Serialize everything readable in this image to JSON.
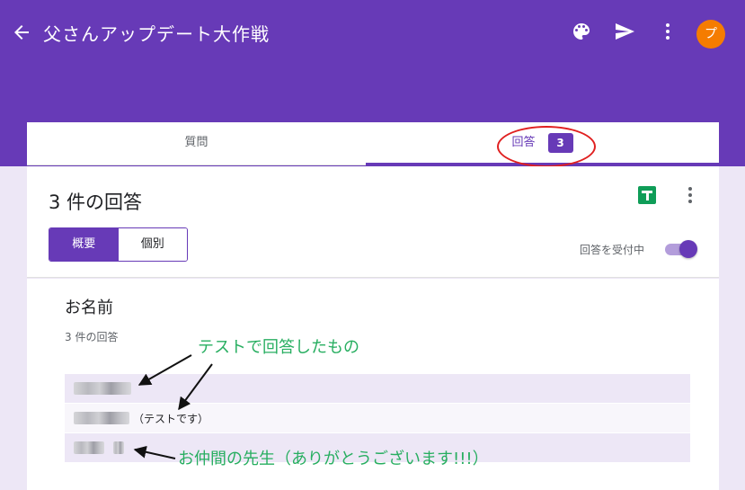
{
  "header": {
    "title": "父さんアップデート大作戦",
    "avatar_initial": "プ",
    "icons": [
      "back-arrow-icon",
      "palette-icon",
      "send-icon",
      "more-vert-icon"
    ],
    "bg_color": "#673ab7"
  },
  "tabs": [
    {
      "label": "質問"
    },
    {
      "label": "回答",
      "badge": "3",
      "active": true
    }
  ],
  "summary": {
    "response_count": "3 件の回答",
    "view_summary": "概要",
    "view_individual": "個別",
    "accepting_label": "回答を受付中",
    "accepting": true
  },
  "question": {
    "title": "お名前",
    "count": "3 件の回答",
    "answers": [
      {
        "suffix": ""
      },
      {
        "suffix": "（テストです）"
      },
      {
        "suffix": ""
      }
    ]
  },
  "annotations": {
    "test_note": "テストで回答したもの",
    "teacher_note": "お仲間の先生（ありがとうございます!!!）",
    "color": "#27ae60",
    "circle_color": "#e02020"
  }
}
